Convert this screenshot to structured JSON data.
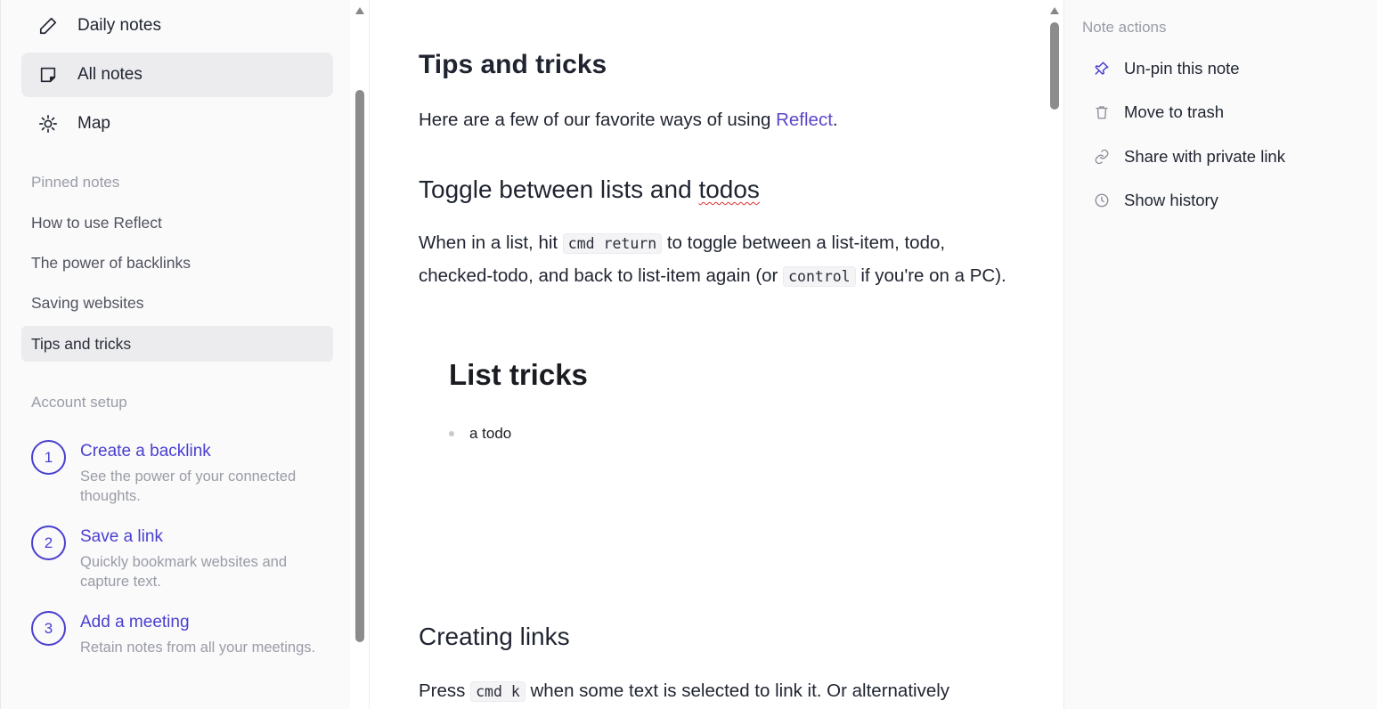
{
  "sidebar": {
    "nav": [
      {
        "label": "Daily notes",
        "icon": "pencil-icon"
      },
      {
        "label": "All notes",
        "icon": "note-icon",
        "active": true
      },
      {
        "label": "Map",
        "icon": "sun-icon"
      }
    ],
    "pinned_title": "Pinned notes",
    "pinned": [
      {
        "label": "How to use Reflect"
      },
      {
        "label": "The power of backlinks"
      },
      {
        "label": "Saving websites"
      },
      {
        "label": "Tips and tricks",
        "active": true
      }
    ],
    "account_title": "Account setup",
    "steps": [
      {
        "num": "1",
        "title": "Create a backlink",
        "desc": "See the power of your connected thoughts."
      },
      {
        "num": "2",
        "title": "Save a link",
        "desc": "Quickly bookmark websites and capture text."
      },
      {
        "num": "3",
        "title": "Add a meeting",
        "desc": "Retain notes from all your meetings."
      }
    ]
  },
  "editor": {
    "title": "Tips and tricks",
    "intro_before": "Here are a few of our favorite ways of using ",
    "intro_link": "Reflect",
    "intro_after": ".",
    "section1_heading_a": "Toggle between lists and ",
    "section1_heading_b": "todos",
    "s1_p1": "When in a list, hit ",
    "s1_code1": "cmd return",
    "s1_p2": " to toggle between a list-item, todo, checked-todo, and back to list-item again (or ",
    "s1_code2": "control",
    "s1_p3": " if you're on a PC).",
    "list_heading": "List tricks",
    "list_item": "a todo",
    "section2_heading": "Creating links",
    "s2_p1": "Press ",
    "s2_code": "cmd k",
    "s2_p2": " when some text is selected to link it. Or alternatively"
  },
  "actions": {
    "title": "Note actions",
    "items": [
      {
        "label": "Un-pin this note",
        "icon": "pin-icon"
      },
      {
        "label": "Move to trash",
        "icon": "trash-icon"
      },
      {
        "label": "Share with private link",
        "icon": "link-icon"
      },
      {
        "label": "Show history",
        "icon": "clock-icon"
      }
    ]
  },
  "colors": {
    "accent": "#4a3fcf",
    "link": "#5a47c9",
    "muted": "#9a9ca6"
  }
}
